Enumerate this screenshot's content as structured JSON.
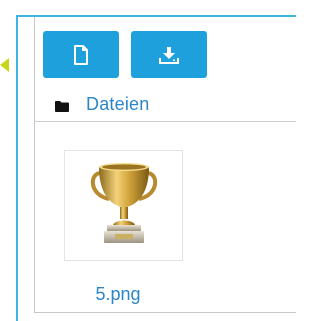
{
  "file_manager": {
    "toolbar": {
      "new_file_icon": "file-icon",
      "upload_icon": "download-icon"
    },
    "breadcrumb": {
      "folder_icon": "folder-icon",
      "label": "Dateien"
    },
    "files": [
      {
        "name": "5.png",
        "thumbnail": "trophy-image"
      }
    ]
  },
  "colors": {
    "accent": "#1ea0dc",
    "link": "#2b86c9",
    "frame": "#3fb4e0"
  }
}
